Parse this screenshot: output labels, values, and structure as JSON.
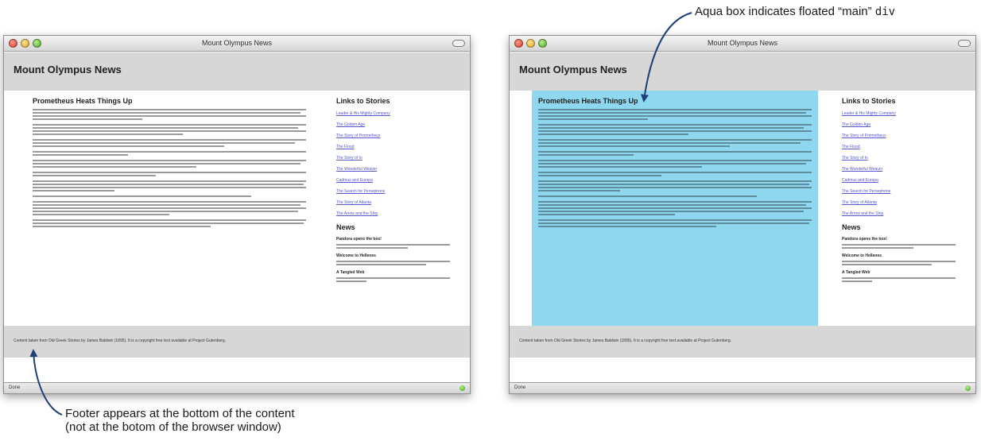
{
  "window": {
    "title": "Mount Olympus News",
    "status": "Done"
  },
  "site": {
    "title": "Mount Olympus News",
    "article_heading": "Prometheus Heats Things Up",
    "links_heading": "Links to Stories",
    "links": [
      "Leader & His Mighty Company",
      "The Golden Age",
      "The Story of Prometheus",
      "The Flood",
      "The Story of Io",
      "The Wonderful Weaver",
      "Cadmus and Europa",
      "The Search for Persephone",
      "The Story of Atlanta",
      "The Arrow and the Ship"
    ],
    "news_heading": "News",
    "news": [
      {
        "title": "Pandora opens the box!"
      },
      {
        "title": "Welcome to Hellenes"
      },
      {
        "title": "A Tangled Web"
      }
    ],
    "footer": "Content taken from Old Greek Stories by James Baldwin (1895). It is a copyright free text available at Project Gutenberg."
  },
  "annotations": {
    "top_prefix": "Aqua box indicates floated “main” ",
    "top_code": "div",
    "bottom_line1": "Footer appears at the bottom of the content",
    "bottom_line2": "(not at the botom of the browser window)"
  },
  "colors": {
    "aqua_main_div": "#8fd7ee",
    "arrow": "#1f3f7a",
    "gray_band": "#d7d7d7",
    "link": "#5555cc"
  }
}
